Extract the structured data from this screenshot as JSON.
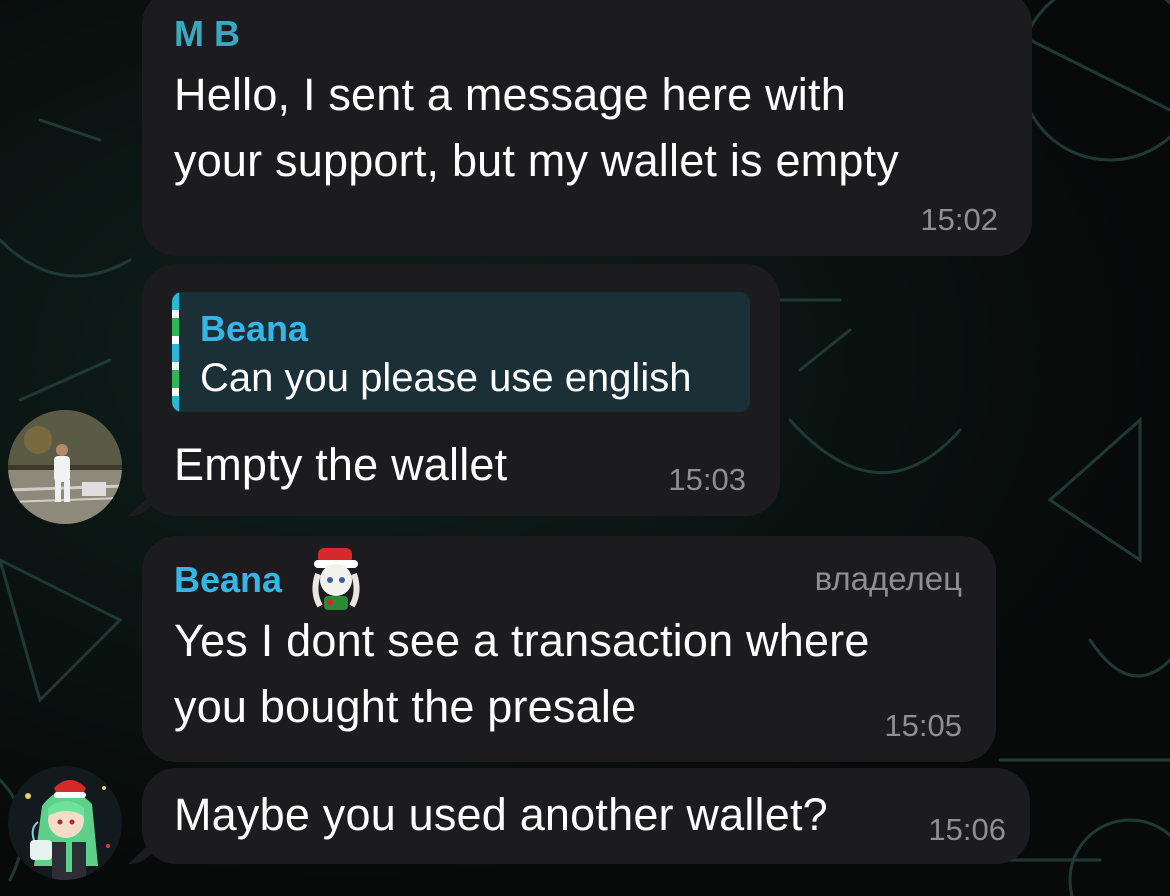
{
  "colors": {
    "bubble_bg": "#1c1c1e",
    "sender_mb": "#3aa7c3",
    "sender_beana": "#35b6e8",
    "reply_bg": "#1b3036",
    "meta_gray": "#8e8e93"
  },
  "messages": [
    {
      "sender": "M B",
      "lines": [
        "Hello, I sent a message here with",
        "your support, but my wallet is empty"
      ],
      "time": "15:02"
    },
    {
      "reply": {
        "name": "Beana",
        "text": "Can you please use english"
      },
      "lines": [
        "Empty the wallet"
      ],
      "time": "15:03",
      "avatar": "user-photo-avatar"
    },
    {
      "sender": "Beana",
      "role": "владелец",
      "sender_badge_icon": "santa-girl-sticker-icon",
      "lines": [
        "Yes I dont see a transaction where",
        "you bought the presale"
      ],
      "time": "15:05"
    },
    {
      "lines": [
        "Maybe you used another wallet?"
      ],
      "time": "15:06",
      "avatar": "anime-girl-avatar"
    }
  ]
}
